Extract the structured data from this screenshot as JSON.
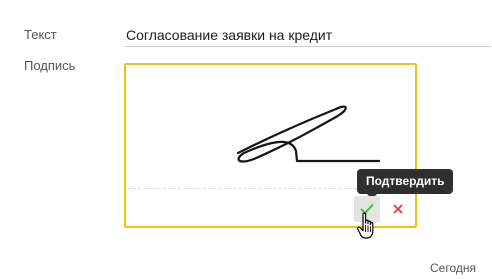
{
  "form": {
    "text_label": "Текст",
    "text_value": "Согласование заявки на кредит",
    "signature_label": "Подпись"
  },
  "signature": {
    "confirm_tooltip": "Подтвердить",
    "confirm_icon": "check-icon",
    "cancel_icon": "close-icon"
  },
  "footer": {
    "date": "Сегодня"
  },
  "colors": {
    "accent_border": "#f2bf16",
    "confirm_green": "#4caf50",
    "cancel_red": "#e53935",
    "tooltip_bg": "#2f2f2f"
  }
}
